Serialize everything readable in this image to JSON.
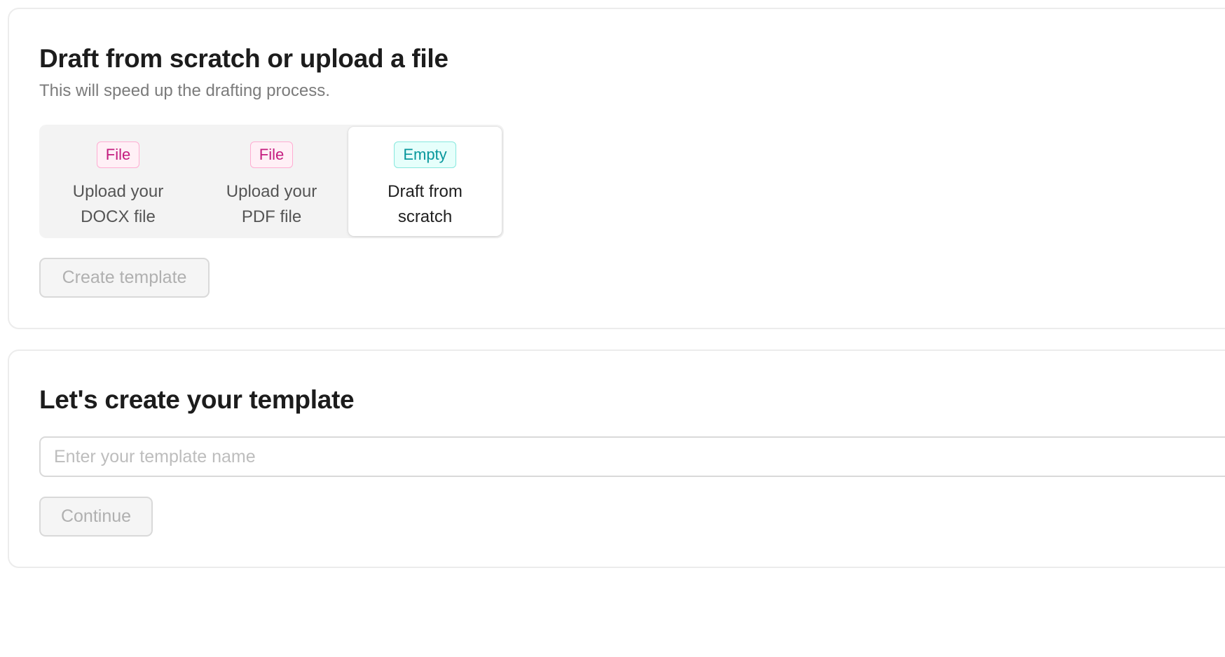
{
  "upload_section": {
    "title": "Draft from scratch or upload a file",
    "subtitle": "This will speed up the drafting process.",
    "options": [
      {
        "tag": "File",
        "label": "Upload your DOCX file",
        "selected": false
      },
      {
        "tag": "File",
        "label": "Upload your PDF file",
        "selected": false
      },
      {
        "tag": "Empty",
        "label": "Draft from scratch",
        "selected": true
      }
    ],
    "create_button_label": "Create template",
    "create_button_disabled": true
  },
  "template_section": {
    "title": "Let's create your template",
    "name_input": {
      "value": "",
      "placeholder": "Enter your template name"
    },
    "continue_button_label": "Continue",
    "continue_button_disabled": true
  },
  "colors": {
    "file_tag": "#c41d7f",
    "empty_tag": "#08979c",
    "disabled_text": "#b0b0b0"
  }
}
